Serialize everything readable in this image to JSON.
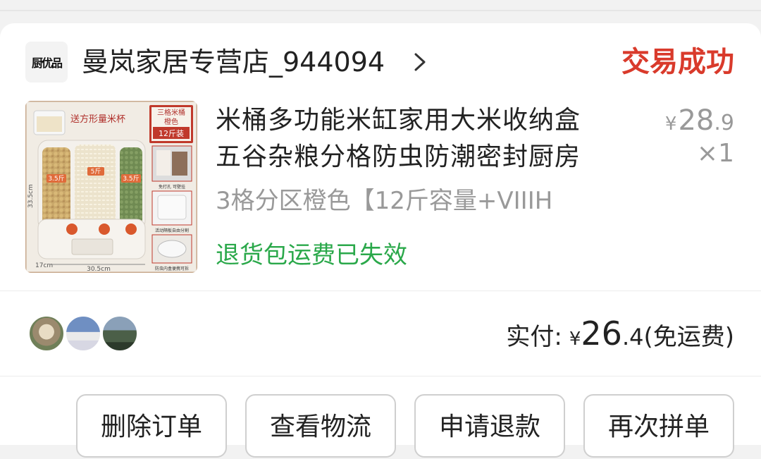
{
  "shop": {
    "logo_text": "厨优品",
    "name": "曼岚家居专营店_944094",
    "chevron_icon": "chevron-right-icon"
  },
  "order": {
    "status": "交易成功",
    "status_color": "#d93a2b"
  },
  "product": {
    "image_texts": {
      "cup_label": "送方形量米杯",
      "badge_line1": "三格米桶",
      "badge_line2": "橙色",
      "badge_line3": "12斤装",
      "left_tag": "3.5斤",
      "center_tag": "5斤",
      "right_tag": "3.5斤",
      "height_dim": "33.5cm",
      "width_dim": "30.5cm",
      "depth_dim": "17cm",
      "thumb1_caption": "免打孔 可壁挂",
      "thumb2_caption": "活动隔板自由分割",
      "thumb3_caption": "防虫内盒便携可拆"
    },
    "title_line1": "米桶多功能米缸家用大米收纳盒",
    "title_line2": "五谷杂粮分格防虫防潮密封厨房",
    "spec": "3格分区橙色【12斤容量+VIIIH",
    "return_insurance": "退货包运费已失效",
    "return_insurance_color": "#2aa84a",
    "price_currency": "¥",
    "price_integer": "28",
    "price_decimal": ".9",
    "quantity": "×1"
  },
  "payment": {
    "label": "实付:",
    "currency": "¥",
    "amount_integer": "26",
    "amount_decimal": ".4",
    "shipping_note": "(免运费)"
  },
  "group_avatars": [
    "avatar",
    "avatar",
    "avatar"
  ],
  "actions": {
    "delete_order": "删除订单",
    "view_logistics": "查看物流",
    "request_refund": "申请退款",
    "buy_again": "再次拼单"
  }
}
